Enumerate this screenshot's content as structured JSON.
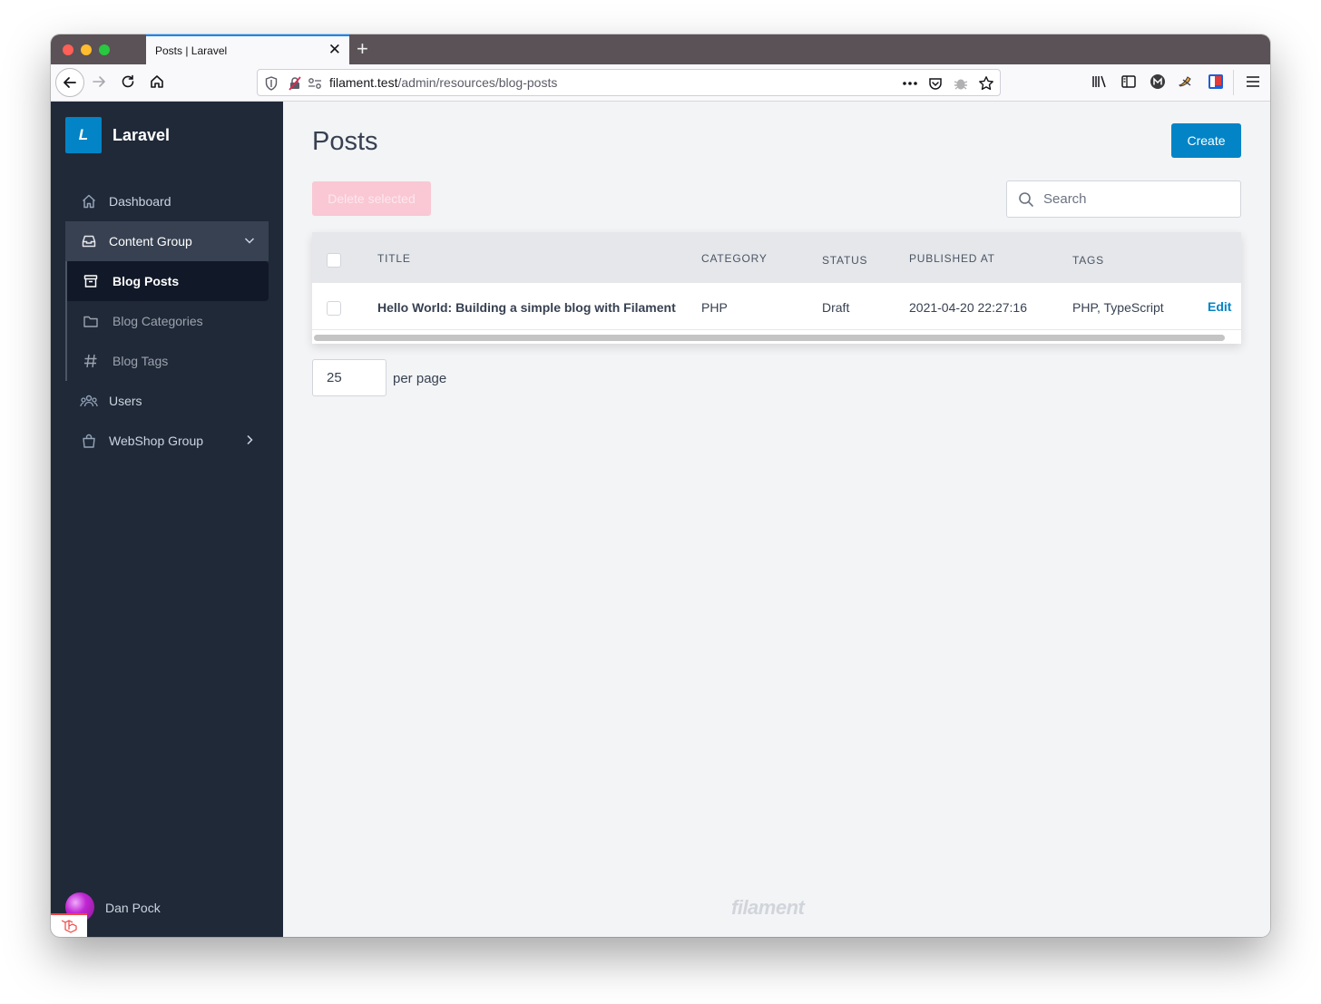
{
  "browser": {
    "tab_title": "Posts | Laravel",
    "tab_close": "✕",
    "new_tab": "+",
    "url_host": "filament.test",
    "url_path": "/admin/resources/blog-posts"
  },
  "sidebar": {
    "brand_logo_letter": "L",
    "brand_name": "Laravel",
    "items": [
      {
        "label": "Dashboard",
        "icon": "home-icon"
      },
      {
        "label": "Content Group",
        "icon": "inbox-icon",
        "expanded": true
      },
      {
        "label": "Blog Posts",
        "icon": "archive-icon",
        "active": true
      },
      {
        "label": "Blog Categories",
        "icon": "folder-icon"
      },
      {
        "label": "Blog Tags",
        "icon": "hashtag-icon"
      },
      {
        "label": "Users",
        "icon": "user-group-icon"
      },
      {
        "label": "WebShop Group",
        "icon": "shopping-bag-icon",
        "expanded": false
      }
    ],
    "user_name": "Dan Pock"
  },
  "main": {
    "page_title": "Posts",
    "create_label": "Create",
    "delete_selected_label": "Delete selected",
    "search_placeholder": "Search",
    "table": {
      "columns": [
        "Title",
        "Category",
        "Status",
        "Published at",
        "Tags"
      ],
      "rows": [
        {
          "title": "Hello World: Building a simple blog with Filament",
          "category": "PHP",
          "status": "Draft",
          "published_at": "2021-04-20 22:27:16",
          "tags": "PHP, TypeScript",
          "action": "Edit"
        }
      ]
    },
    "per_page_value": "25",
    "per_page_label": "per page",
    "footer_brand": "filament"
  },
  "colors": {
    "primary": "#0284c7",
    "sidebar_bg": "#202938",
    "danger_disabled": "#f9c8d4"
  }
}
